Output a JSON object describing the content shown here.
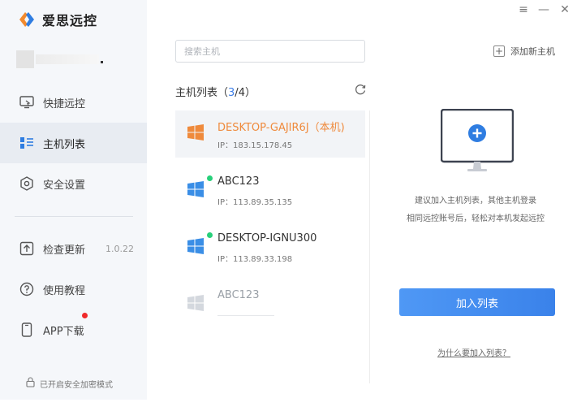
{
  "app": {
    "name": "爱思远控"
  },
  "window_controls": {
    "menu": "≡",
    "minimize": "—",
    "close": "✕"
  },
  "sidebar": {
    "items": [
      {
        "label": "快捷远控",
        "icon": "remote-screen-icon"
      },
      {
        "label": "主机列表",
        "icon": "host-list-icon"
      },
      {
        "label": "安全设置",
        "icon": "shield-gear-icon"
      }
    ],
    "lower_items": [
      {
        "label": "检查更新",
        "icon": "update-icon",
        "version": "1.0.22"
      },
      {
        "label": "使用教程",
        "icon": "help-icon"
      },
      {
        "label": "APP下载",
        "icon": "phone-icon"
      }
    ],
    "footer": "已开启安全加密模式"
  },
  "search": {
    "placeholder": "搜索主机",
    "value": ""
  },
  "host_list": {
    "title_prefix": "主机列表（",
    "online": "3",
    "sep": "/",
    "total": "4",
    "title_suffix": "）",
    "hosts": [
      {
        "name": "DESKTOP-GAJIR6J（本机)",
        "ip": "IP：183.15.178.45",
        "status": "current",
        "color": "#ef8a3c"
      },
      {
        "name": "ABC123",
        "ip": "IP：113.89.35.135",
        "status": "online",
        "color": "#3a8ee6"
      },
      {
        "name": "DESKTOP-IGNU300",
        "ip": "IP：113.89.33.198",
        "status": "online",
        "color": "#3a8ee6"
      },
      {
        "name": "ABC123",
        "ip": "",
        "status": "offline",
        "color": "#d4d8de"
      }
    ]
  },
  "right_panel": {
    "add_host": "添加新主机",
    "tip_line1": "建议加入主机列表，其他主机登录",
    "tip_line2": "相同远控账号后，轻松对本机发起远控",
    "button": "加入列表",
    "link": "为什么要加入列表？"
  },
  "colors": {
    "accent": "#3a82ea",
    "current_host": "#ef8a3c",
    "online": "#27d07a",
    "badge": "#f02a2a"
  }
}
